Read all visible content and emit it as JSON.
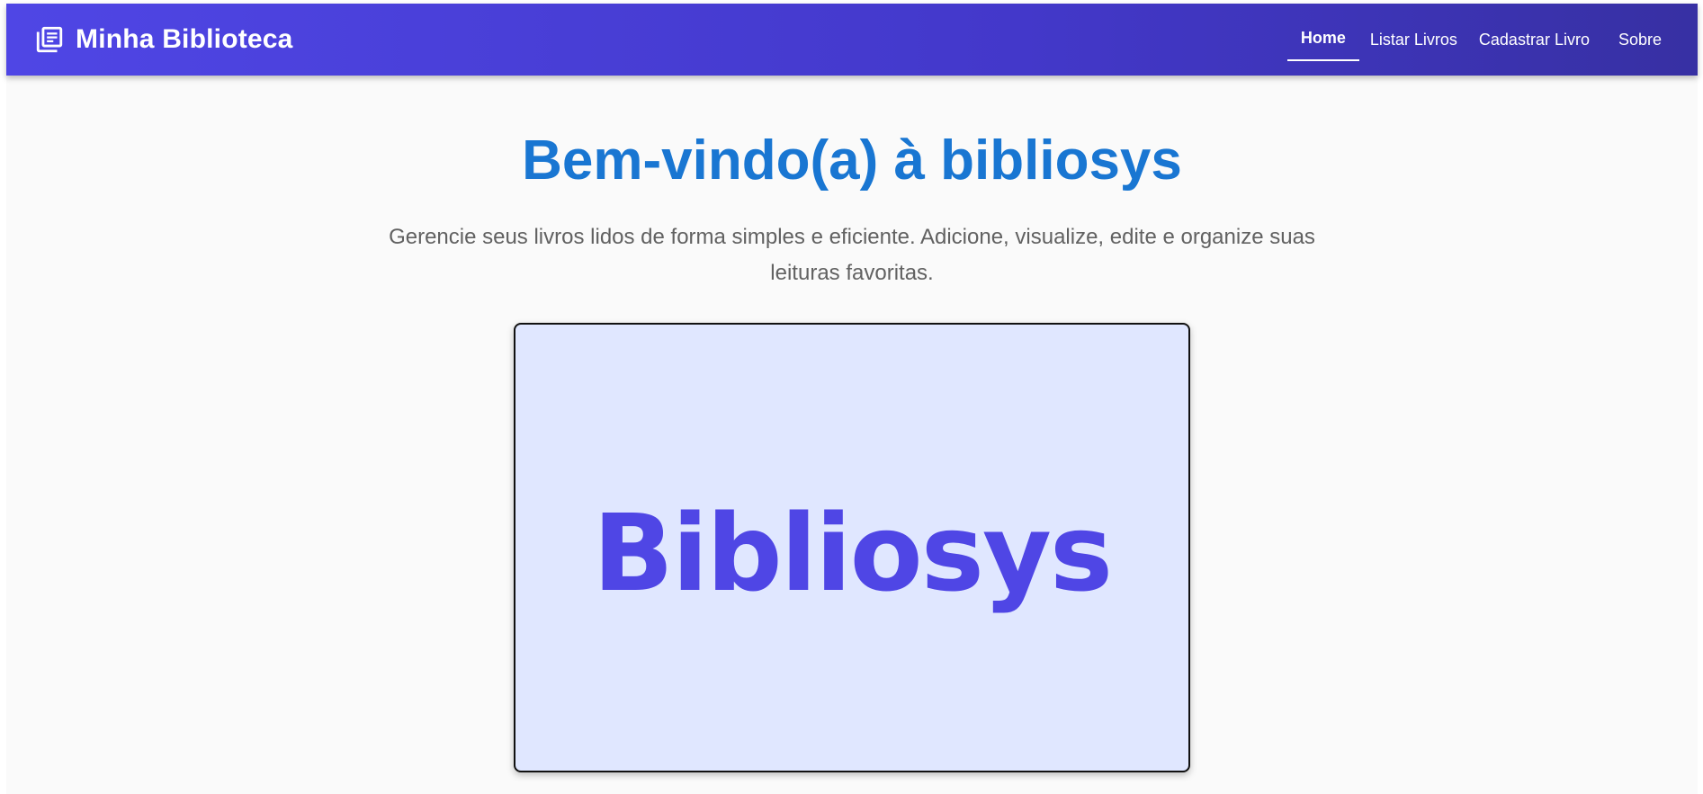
{
  "navbar": {
    "brand_icon": "library-books-icon",
    "brand_title": "Minha Biblioteca",
    "links": [
      {
        "label": "Home",
        "active": true
      },
      {
        "label": "Listar Livros",
        "active": false
      },
      {
        "label": "Cadastrar Livro",
        "active": false
      },
      {
        "label": "Sobre",
        "active": false
      }
    ]
  },
  "hero": {
    "title": "Bem-vindo(a) à bibliosys",
    "subtitle": "Gerencie seus livros lidos de forma simples e eficiente. Adicione, visualize, edite e organize suas leituras favoritas."
  },
  "logo": {
    "text": "Bibliosys"
  },
  "colors": {
    "navbar_gradient_start": "#4f46e5",
    "navbar_gradient_end": "#3730a3",
    "title": "#1976d2",
    "subtitle": "#616161",
    "logo_background": "#e0e7ff",
    "logo_text": "#4f46e5",
    "page_background": "#fafafa"
  }
}
